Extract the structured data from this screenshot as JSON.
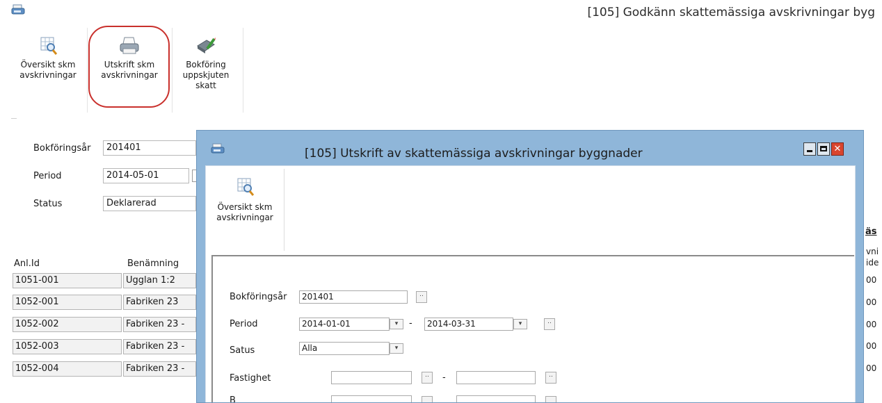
{
  "main": {
    "title": "[105]  Godkänn skattemässiga avskrivningar byg",
    "toolbar": {
      "overview": [
        "Översikt skm",
        "avskrivningar"
      ],
      "print": [
        "Utskrift skm",
        "avskrivningar"
      ],
      "booking": [
        "Bokföring",
        "uppskjuten",
        "skatt"
      ]
    },
    "form": {
      "year_label": "Bokföringsår",
      "year_value": "201401",
      "period_label": "Period",
      "period_value": "2014-05-01",
      "status_label": "Status",
      "status_value": "Deklarerad"
    },
    "table": {
      "headers": [
        "Anl.Id",
        "Benämning"
      ],
      "rows": [
        [
          "1051-001",
          "Ugglan 1:2"
        ],
        [
          "1052-001",
          "Fabriken 23"
        ],
        [
          "1052-002",
          "Fabriken 23 -"
        ],
        [
          "1052-003",
          "Fabriken 23 -"
        ],
        [
          "1052-004",
          "Fabriken 23 -"
        ]
      ]
    },
    "right_fragments": {
      "header_underlined": "äs",
      "sub1": "vni",
      "sub2": "ide",
      "cells": [
        "00",
        "00",
        "00",
        "00",
        "00"
      ]
    }
  },
  "dialog": {
    "title": "[105]  Utskrift av skattemässiga avskrivningar byggnader",
    "toolbar": {
      "overview": [
        "Översikt skm",
        "avskrivningar"
      ]
    },
    "form": {
      "year_label": "Bokföringsår",
      "year_value": "201401",
      "period_label": "Period",
      "period_from": "2014-01-01",
      "period_to": "2014-03-31",
      "status_label": "Satus",
      "status_value": "Alla",
      "property_label": "Fastighet",
      "range_dash": "-",
      "dots": "..",
      "next_label_partial": "B"
    },
    "window_controls": [
      "minimize",
      "maximize",
      "close"
    ]
  },
  "colors": {
    "dialog_frame": "#8fb6d9",
    "highlight": "#c9302c",
    "close_button": "#d9452f"
  }
}
